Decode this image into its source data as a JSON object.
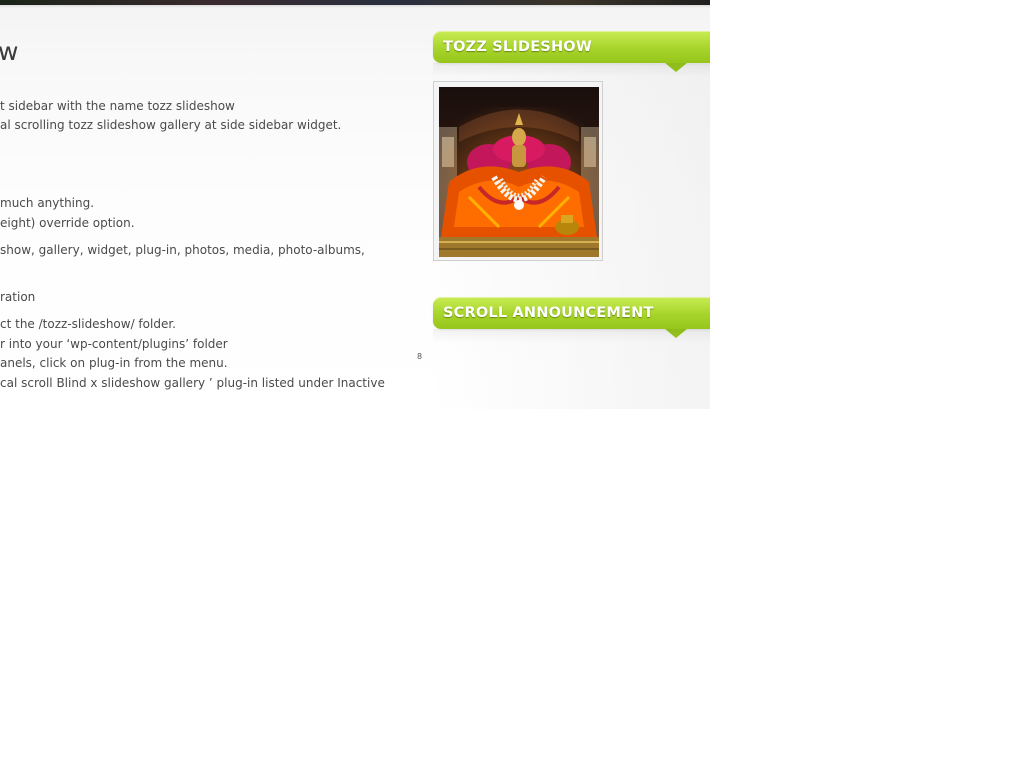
{
  "post": {
    "title_fragment": "w",
    "lines": [
      "t sidebar with the name tozz slideshow",
      "al scrolling tozz slideshow gallery at side sidebar widget.",
      "much anything.",
      "eight) override option.",
      "show, gallery, widget, plug-in, photos, media, photo-albums,",
      "ration",
      "ct the /tozz-slideshow/ folder.",
      "r into your ‘wp-content/plugins’ folder",
      "anels, click on plug-in from the menu.",
      "cal scroll Blind x slideshow gallery ’ plug-in listed under Inactive"
    ],
    "stray_mark": "8"
  },
  "sidebar": {
    "widgets": [
      {
        "title": "TOZZ SLIDESHOW"
      },
      {
        "title": "SCROLL ANNOUNCEMENT"
      }
    ]
  },
  "colors": {
    "widget_green": "#a7d42a",
    "widget_text": "#ffffff",
    "body_text": "#4a4a4a"
  }
}
